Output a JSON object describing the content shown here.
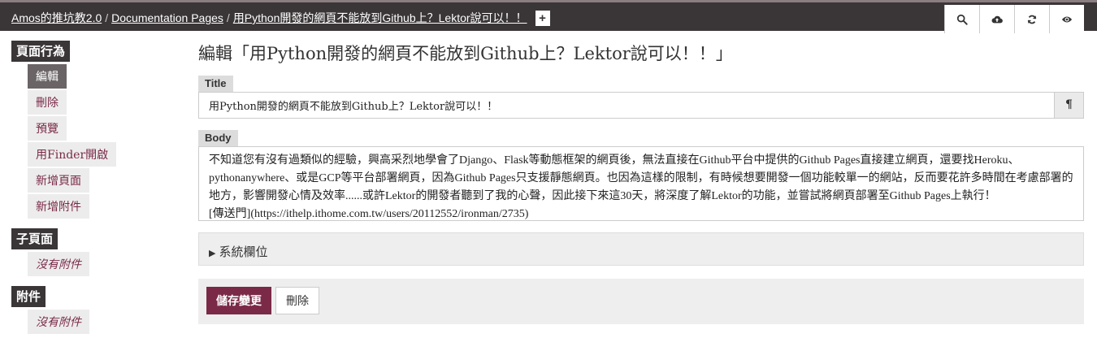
{
  "breadcrumb": {
    "root": "Amos的推坑教2.0",
    "section": "Documentation Pages",
    "current": "用Python開發的網頁不能放到Github上？Lektor說可以！！",
    "add_label": "+"
  },
  "toolbar": {
    "icons": [
      "search-icon",
      "cloud-upload-icon",
      "refresh-icon",
      "eye-icon"
    ]
  },
  "sidebar": {
    "page_actions": {
      "heading": "頁面行為",
      "items": [
        {
          "label": "編輯",
          "active": true
        },
        {
          "label": "刪除"
        },
        {
          "label": "預覽"
        },
        {
          "label": "用Finder開啟"
        },
        {
          "label": "新增頁面"
        },
        {
          "label": "新增附件"
        }
      ]
    },
    "subpages": {
      "heading": "子頁面",
      "empty": "沒有附件"
    },
    "attachments": {
      "heading": "附件",
      "empty": "沒有附件"
    }
  },
  "main": {
    "title": "編輯「用Python開發的網頁不能放到Github上？Lektor說可以！！」",
    "title_field": {
      "label": "Title",
      "value": "用Python開發的網頁不能放到Github上？Lektor說可以！！",
      "toggle": "¶"
    },
    "body_field": {
      "label": "Body",
      "value": "不知道您有沒有過類似的經驗，興高采烈地學會了Django、Flask等動態框架的網頁後，無法直接在Github平台中提供的Github Pages直接建立網頁，還要找Heroku、pythonanywhere、或是GCP等平台部署網頁，因為Github Pages只支援靜態網頁。也因為這樣的限制，有時候想要開發一個功能較單一的網站，反而要花許多時間在考慮部署的地方，影響開發心情及效率......或許Lektor的開發者聽到了我的心聲，因此接下來這30天，將深度了解Lektor的功能，並嘗試將網頁部署至Github Pages上執行！\n[傳送門](https://ithelp.ithome.com.tw/users/20112552/ironman/2735)"
    },
    "system_fields": "系統欄位",
    "save_label": "儲存變更",
    "delete_label": "刪除"
  }
}
